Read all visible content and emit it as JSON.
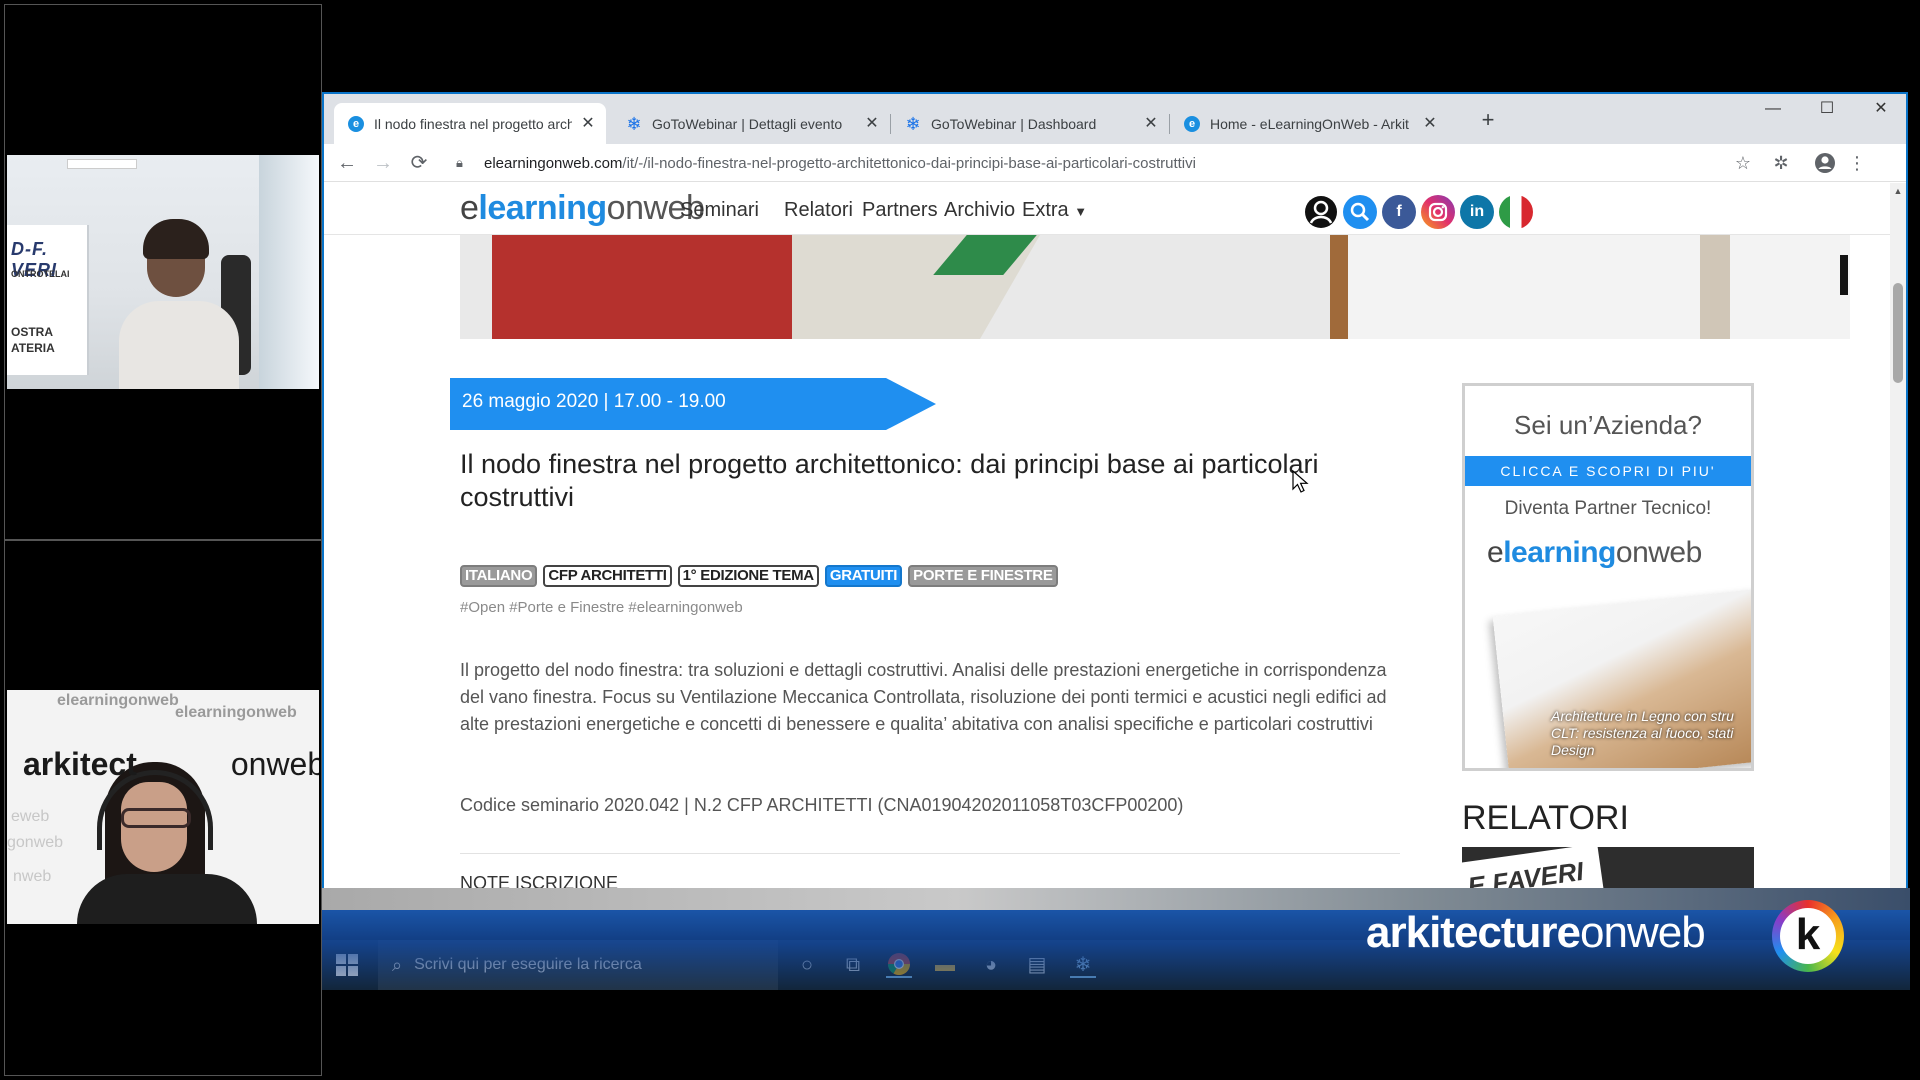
{
  "video_panel": {
    "cam1_banner_brand": "D-F. VERI",
    "cam1_banner_line1": "ONTROTELAI",
    "cam1_banner_line2": "OSTRA",
    "cam1_banner_line3": "ATERIA",
    "cam2_watermark_1": "elearningonweb",
    "cam2_watermark_2": "elearningonweb",
    "cam2_watermark_3": "eweb",
    "cam2_watermark_4": "gonweb",
    "cam2_watermark_5": "nweb",
    "cam2_logo_bold": "arkitect",
    "cam2_logo_light": "onweb"
  },
  "browser": {
    "tabs": [
      {
        "label": "Il nodo finestra nel progetto arch",
        "icon": "ie-icon",
        "active": true
      },
      {
        "label": "GoToWebinar | Dettagli evento",
        "icon": "gotowebinar-icon",
        "active": false
      },
      {
        "label": "GoToWebinar | Dashboard",
        "icon": "gotowebinar-icon",
        "active": false
      },
      {
        "label": "Home - eLearningOnWeb - Arkit",
        "icon": "ie-icon",
        "active": false
      }
    ],
    "new_tab_label": "+",
    "window_controls": {
      "minimize": "—",
      "maximize": "☐",
      "close": "✕"
    },
    "address": {
      "domain": "elearningonweb.com",
      "path": "/it/-/il-nodo-finestra-nel-progetto-architettonico-dai-principi-base-ai-particolari-costruttivi"
    }
  },
  "site": {
    "logo_e": "e",
    "logo_learning": "learning",
    "logo_onweb": "onweb",
    "menu": [
      "Seminari",
      "Relatori",
      "Partners",
      "Archivio",
      "Extra"
    ],
    "social": [
      {
        "name": "user-icon",
        "glyph": "",
        "color": "#111111"
      },
      {
        "name": "search-icon",
        "glyph": "",
        "color": "#1f8ff0"
      },
      {
        "name": "facebook-icon",
        "glyph": "f",
        "color": "#3b5998"
      },
      {
        "name": "instagram-icon",
        "glyph": "",
        "color": "#c13584"
      },
      {
        "name": "linkedin-icon",
        "glyph": "in",
        "color": "#0e76a8"
      },
      {
        "name": "italian-flag-icon",
        "glyph": "",
        "color": "#ffffff"
      }
    ]
  },
  "event": {
    "date": "26 maggio 2020 | 17.00 - 19.00",
    "title": "Il nodo finestra nel progetto architettonico: dai principi base ai particolari costruttivi",
    "badges": [
      {
        "label": "ITALIANO",
        "style": "grey"
      },
      {
        "label": "CFP ARCHITETTI",
        "style": "outline"
      },
      {
        "label": "1° EDIZIONE TEMA",
        "style": "outline"
      },
      {
        "label": "GRATUITI",
        "style": "blue"
      },
      {
        "label": "PORTE E FINESTRE",
        "style": "grey"
      }
    ],
    "hashtags": "#Open #Porte e Finestre #elearningonweb",
    "description": "Il progetto del nodo finestra: tra soluzioni e dettagli costruttivi. Analisi delle prestazioni energetiche in corrispondenza del vano finestra. Focus su Ventilazione Meccanica Controllata, risoluzione dei ponti termici e acustici negli edifici ad alte prestazioni energetiche e concetti di benessere e qualita’ abitativa con analisi specifiche e particolari costruttivi",
    "code_line": "Codice seminario 2020.042 | N.2 CFP ARCHITETTI (CNA01904202011058T03CFP00200)",
    "note_title": "NOTE ISCRIZIONE"
  },
  "sidebar_ad": {
    "question": "Sei un’Azienda?",
    "cta": "CLICCA E SCOPRI DI PIU'",
    "partner": "Diventa Partner Tecnico!",
    "magazine_caption_1": "Architetture in Legno con stru",
    "magazine_caption_2": "CLT: resistenza al fuoco, stati",
    "magazine_caption_3": "Design"
  },
  "relatori": {
    "title": "RELATORI",
    "photo_sign": "E FAVERI"
  },
  "taskbar": {
    "search_placeholder": "Scrivi qui per eseguire la ricerca"
  },
  "overlay": {
    "brand_bold": "arkitecture",
    "brand_light": "onweb",
    "k_logo": "k"
  },
  "colors": {
    "accent": "#1f8ff0",
    "ribbon": "#236ed2",
    "taskbar": "#16293a"
  }
}
